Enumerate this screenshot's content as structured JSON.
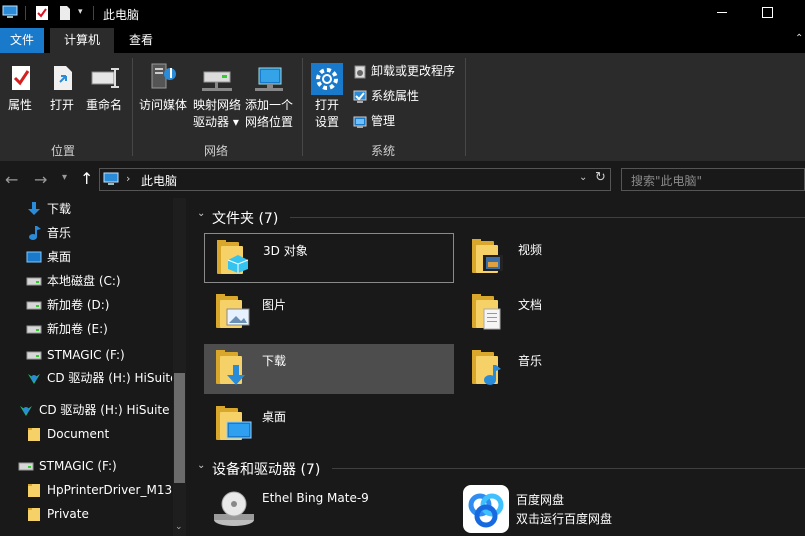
{
  "window": {
    "title": "此电脑"
  },
  "ribbon": {
    "tabs": [
      {
        "label": "文件",
        "active_style": "blue"
      },
      {
        "label": "计算机",
        "active_style": "selected"
      },
      {
        "label": "查看",
        "active_style": "none"
      }
    ],
    "groups": {
      "location": {
        "label": "位置",
        "buttons": [
          "属性",
          "打开",
          "重命名"
        ]
      },
      "network": {
        "label": "网络",
        "buttons": [
          {
            "line1": "访问媒体",
            "line2": ""
          },
          {
            "line1": "映射网络",
            "line2": "驱动器 ▾"
          },
          {
            "line1": "添加一个",
            "line2": "网络位置"
          }
        ]
      },
      "system": {
        "label": "系统",
        "open_settings": {
          "line1": "打开",
          "line2": "设置"
        },
        "small_buttons": [
          "卸载或更改程序",
          "系统属性",
          "管理"
        ]
      }
    }
  },
  "address": {
    "path": "此电脑",
    "search_placeholder": "搜索\"此电脑\""
  },
  "nav": {
    "items": [
      {
        "label": "下载",
        "icon": "download-arrow-icon"
      },
      {
        "label": "音乐",
        "icon": "music-note-icon"
      },
      {
        "label": "桌面",
        "icon": "desktop-icon"
      },
      {
        "label": "本地磁盘 (C:)",
        "icon": "drive-icon"
      },
      {
        "label": "新加卷 (D:)",
        "icon": "drive-icon"
      },
      {
        "label": "新加卷 (E:)",
        "icon": "drive-icon"
      },
      {
        "label": "STMAGIC (F:)",
        "icon": "drive-icon"
      },
      {
        "label": "CD 驱动器 (H:) HiSuite",
        "icon": "hisuite-cd-icon"
      },
      {
        "label": "CD 驱动器 (H:) HiSuite",
        "icon": "hisuite-cd-icon"
      },
      {
        "label": "Document",
        "icon": "folder-icon"
      },
      {
        "label": "STMAGIC (F:)",
        "icon": "drive-icon"
      },
      {
        "label": "HpPrinterDriver_M13",
        "icon": "folder-icon"
      },
      {
        "label": "Private",
        "icon": "folder-icon"
      }
    ]
  },
  "content": {
    "folders_title": "文件夹 (7)",
    "folders": [
      {
        "label": "3D 对象",
        "icon": "3d-objects-icon"
      },
      {
        "label": "视频",
        "icon": "video-icon"
      },
      {
        "label": "图片",
        "icon": "pictures-icon"
      },
      {
        "label": "文档",
        "icon": "documents-icon"
      },
      {
        "label": "下载",
        "icon": "download-arrow-icon"
      },
      {
        "label": "音乐",
        "icon": "music-note-icon"
      },
      {
        "label": "桌面",
        "icon": "desktop-icon"
      }
    ],
    "devices_title": "设备和驱动器 (7)",
    "devices": [
      {
        "label": "Ethel Bing Mate-9",
        "sublabel": "",
        "icon": "media-device-icon"
      },
      {
        "label": "百度网盘",
        "sublabel": "双击运行百度网盘",
        "icon": "baidu-netdisk-icon"
      }
    ]
  },
  "colors": {
    "accent": "#1979ca",
    "folder": "#f6d167",
    "selected_tile": "#4d4d4d"
  }
}
